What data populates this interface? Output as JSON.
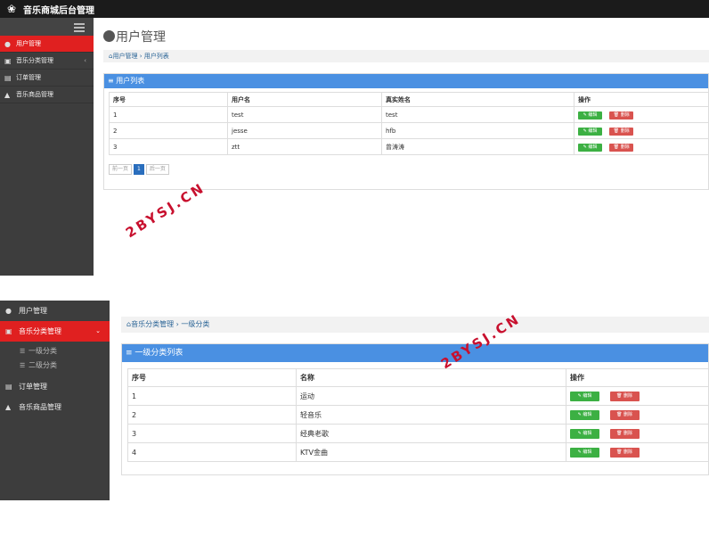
{
  "app": {
    "title": "音乐商城后台管理"
  },
  "panel1": {
    "sidebar": [
      {
        "icon": "user-circle-icon",
        "label": "用户管理"
      },
      {
        "icon": "category-icon",
        "label": "音乐分类管理",
        "chevron": "‹"
      },
      {
        "icon": "file-icon",
        "label": "订单管理"
      },
      {
        "icon": "store-icon",
        "label": "音乐商品管理"
      }
    ],
    "page_title": "用户管理",
    "breadcrumb": {
      "home": "用户管理",
      "sep": "›",
      "current": "用户列表"
    },
    "panel_title": "用户列表",
    "columns": [
      "序号",
      "用户名",
      "真实姓名",
      "操作"
    ],
    "rows": [
      {
        "id": "1",
        "username": "test",
        "realname": "test"
      },
      {
        "id": "2",
        "username": "jesse",
        "realname": "hfb"
      },
      {
        "id": "3",
        "username": "ztt",
        "realname": "曾涛涛"
      }
    ],
    "edit_label": "编辑",
    "delete_label": "删除",
    "pager": {
      "prev": "前一页",
      "current": "1",
      "next": "后一页"
    }
  },
  "panel2": {
    "sidebar": [
      {
        "icon": "user-circle-icon",
        "label": "用户管理"
      },
      {
        "icon": "category-icon",
        "label": "音乐分类管理",
        "chevron": "⌄"
      },
      {
        "icon": "file-icon",
        "label": "订单管理"
      },
      {
        "icon": "store-icon",
        "label": "音乐商品管理"
      }
    ],
    "subitems": [
      "一级分类",
      "二级分类"
    ],
    "breadcrumb": {
      "home": "音乐分类管理",
      "sep": "›",
      "current": "一级分类"
    },
    "panel_title": "一级分类列表",
    "columns": [
      "序号",
      "名称",
      "操作"
    ],
    "rows": [
      {
        "id": "1",
        "name": "运动"
      },
      {
        "id": "2",
        "name": "轻音乐"
      },
      {
        "id": "3",
        "name": "经典老歌"
      },
      {
        "id": "4",
        "name": "KTV金曲"
      }
    ],
    "edit_label": "编辑",
    "delete_label": "删除"
  },
  "watermark": "2BYSJ.CN",
  "colors": {
    "accent_red": "#e02020",
    "panel_blue": "#4a90e2",
    "sidebar_dark": "#3d3d3d",
    "edit_green": "#3cb043",
    "delete_red": "#d9534f"
  }
}
